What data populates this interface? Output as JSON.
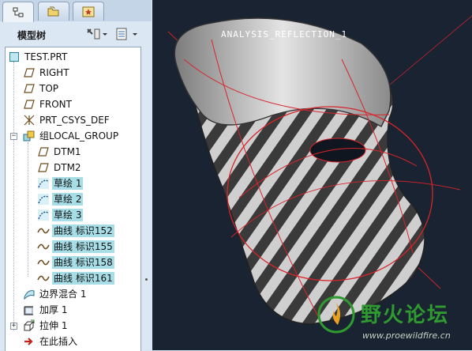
{
  "panel": {
    "title": "模型树",
    "tabs": [
      {
        "name": "model-tree",
        "icon": "tree-icon"
      },
      {
        "name": "folders",
        "icon": "folder-icon"
      },
      {
        "name": "favorites",
        "icon": "star-icon"
      }
    ],
    "tools": [
      "settings-tool-icon",
      "tree-filter-icon"
    ]
  },
  "tree": {
    "items": [
      {
        "label": "TEST.PRT",
        "icon": "part-icon",
        "level": 0,
        "selected": false
      },
      {
        "label": "RIGHT",
        "icon": "datum-plane-icon",
        "level": 1,
        "selected": false
      },
      {
        "label": "TOP",
        "icon": "datum-plane-icon",
        "level": 1,
        "selected": false
      },
      {
        "label": "FRONT",
        "icon": "datum-plane-icon",
        "level": 1,
        "selected": false
      },
      {
        "label": "PRT_CSYS_DEF",
        "icon": "csys-icon",
        "level": 1,
        "selected": false
      },
      {
        "label": "组LOCAL_GROUP",
        "icon": "group-icon",
        "level": 1,
        "selected": false,
        "expanded": true
      },
      {
        "label": "DTM1",
        "icon": "datum-plane-icon",
        "level": 2,
        "selected": false
      },
      {
        "label": "DTM2",
        "icon": "datum-plane-icon",
        "level": 2,
        "selected": false
      },
      {
        "label": "草绘 1",
        "icon": "sketch-icon",
        "level": 2,
        "selected": true
      },
      {
        "label": "草绘 2",
        "icon": "sketch-icon",
        "level": 2,
        "selected": true
      },
      {
        "label": "草绘 3",
        "icon": "sketch-icon",
        "level": 2,
        "selected": true
      },
      {
        "label": "曲线 标识152",
        "icon": "curve-icon",
        "level": 2,
        "selected": true
      },
      {
        "label": "曲线 标识155",
        "icon": "curve-icon",
        "level": 2,
        "selected": true
      },
      {
        "label": "曲线 标识158",
        "icon": "curve-icon",
        "level": 2,
        "selected": true
      },
      {
        "label": "曲线 标识161",
        "icon": "curve-icon",
        "level": 2,
        "selected": true
      },
      {
        "label": "边界混合 1",
        "icon": "boundary-blend-icon",
        "level": 1,
        "selected": false
      },
      {
        "label": "加厚 1",
        "icon": "thicken-icon",
        "level": 1,
        "selected": false
      },
      {
        "label": "拉伸 1",
        "icon": "extrude-icon",
        "level": 1,
        "selected": false,
        "expandable": true
      },
      {
        "label": "在此插入",
        "icon": "insert-here-arrow-icon",
        "level": 1,
        "selected": false
      }
    ]
  },
  "viewport": {
    "analysis_label": "ANALYSIS_REFLECTION_1",
    "background": "#1a2331"
  },
  "watermark": {
    "text": "野火论坛",
    "url": "www.proewildfire.cn"
  },
  "colors": {
    "selection": "#a6dde6",
    "accent_red": "#e02020",
    "watermark_green": "#2f9a2f"
  }
}
